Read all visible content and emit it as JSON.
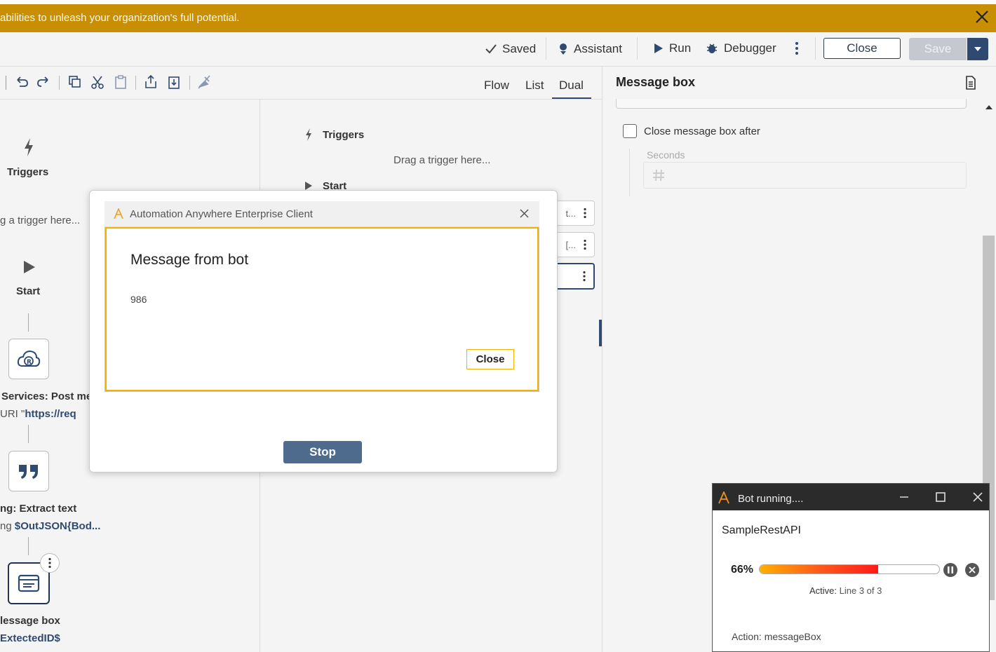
{
  "banner": {
    "text": "abilities to unleash your organization's full potential."
  },
  "topbar": {
    "saved_label": "Saved",
    "assistant_label": "Assistant",
    "run_label": "Run",
    "debugger_label": "Debugger",
    "close_label": "Close",
    "save_label": "Save"
  },
  "tabs": [
    {
      "label": "Flow"
    },
    {
      "label": "List"
    },
    {
      "label": "Dual",
      "active": true
    }
  ],
  "flow": {
    "triggers_label": "Triggers",
    "drag_trigger": "g a trigger here...",
    "start_label": "Start",
    "node1_title": "Services: Post me",
    "node1_sub_prefix": "URI \"",
    "node1_sub_value": "https://req",
    "node2_title": "ng: Extract text",
    "node2_sub_prefix": "ng ",
    "node2_sub_value": "$OutJSON{Bod...",
    "node3_title": "lessage box",
    "node3_sub_value": "ExtectedID$"
  },
  "list": {
    "triggers_label": "Triggers",
    "drag_trigger": "Drag a trigger here...",
    "start_label": "Start",
    "row1_tail": "t...",
    "row2_tail": "[..."
  },
  "properties": {
    "title": "Message box",
    "close_after_label": "Close message box after",
    "seconds_label": "Seconds"
  },
  "message_dialog": {
    "window_title": "Automation Anywhere Enterprise Client",
    "heading": "Message from bot",
    "message": "986",
    "close_label": "Close",
    "stop_label": "Stop"
  },
  "bot_runner": {
    "title": "Bot running....",
    "bot_name": "SampleRestAPI",
    "progress_text": "66%",
    "progress": 0.66,
    "active_label": "Active:",
    "active_value": "Line 3 of 3",
    "action_label": "Action:",
    "action_value": "messageBox"
  },
  "colors": {
    "banner": "#c88f05",
    "accent": "#2f4a70",
    "dialog_border": "#f2b200",
    "stop_button": "#4e6a8c"
  }
}
